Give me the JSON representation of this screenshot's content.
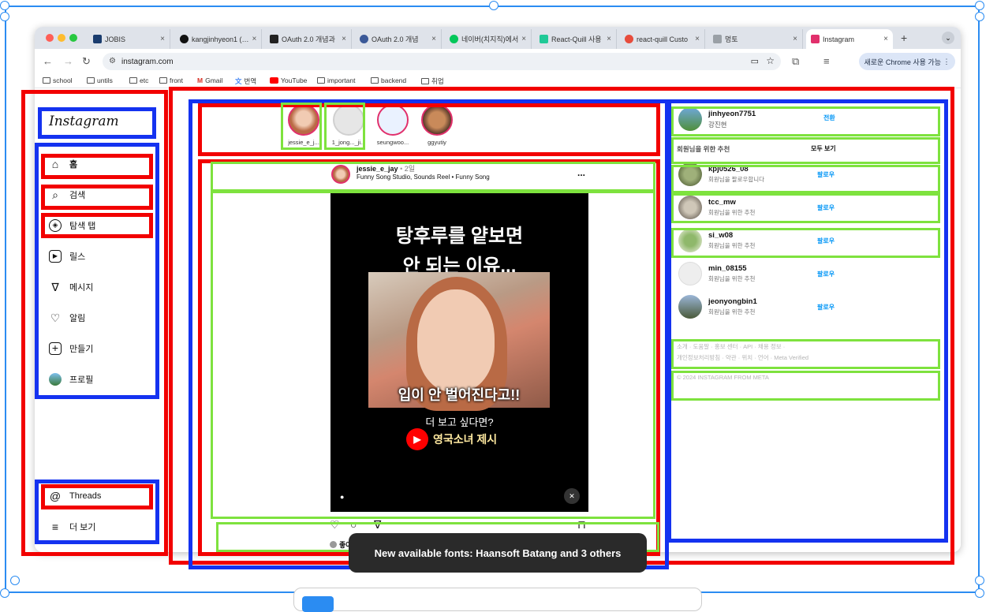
{
  "browser": {
    "tabs": [
      {
        "label": "JOBIS",
        "color": "#1a3c6e"
      },
      {
        "label": "kangjinhyeon1 (…",
        "color": "#111111"
      },
      {
        "label": "OAuth 2.0 개념과",
        "color": "#222222"
      },
      {
        "label": "OAuth 2.0 개념",
        "color": "#3b5998"
      },
      {
        "label": "네이버(치지직)에서",
        "color": "#03c75a"
      },
      {
        "label": "React-Quill 사용",
        "color": "#20c997"
      },
      {
        "label": "react-quill Custo",
        "color": "#e74c3c"
      },
      {
        "label": "멍토",
        "color": "#9aa0a6"
      },
      {
        "label": "Instagram",
        "color": "#e1306c"
      }
    ],
    "new_tab": "+",
    "url": "instagram.com",
    "chrome_button": "새로운 Chrome 사용 가능",
    "bookmarks": [
      "school",
      "untils",
      "etc",
      "front",
      "Gmail",
      "번역",
      "YouTube",
      "important",
      "backend",
      "취업"
    ]
  },
  "sidebar": {
    "logo": "Instagram",
    "items": [
      {
        "label": "홈",
        "icon": "home-icon"
      },
      {
        "label": "검색",
        "icon": "search-icon"
      },
      {
        "label": "탐색 탭",
        "icon": "compass-icon"
      },
      {
        "label": "릴스",
        "icon": "reels-icon"
      },
      {
        "label": "메시지",
        "icon": "send-icon"
      },
      {
        "label": "알림",
        "icon": "heart-icon"
      },
      {
        "label": "만들기",
        "icon": "plus-square-icon"
      },
      {
        "label": "프로필",
        "icon": "profile-avatar"
      }
    ],
    "threads": "Threads",
    "more": "더 보기"
  },
  "stories": [
    {
      "name": "jessie_e_j..."
    },
    {
      "name": "1_jong..._ji..."
    },
    {
      "name": "seungwoo..."
    },
    {
      "name": "ggyutiy"
    }
  ],
  "post": {
    "author": "jessie_e_jay",
    "time": "2일",
    "audio": "Funny Song Studio, Sounds Reel • Funny Song",
    "more": "...",
    "reel_title_line1": "탕후루를 얕보면",
    "reel_title_line2": "안 되는 이유...",
    "photo_caption": "입이 안 벌어진다고!!",
    "cta": "더 보고 싶다면?",
    "channel": "영국소녀 제시",
    "likes_prefix": "좋아"
  },
  "toast": "New available fonts: Haansoft Batang and 3 others",
  "suggestions": {
    "me": {
      "username": "jinhyeon7751",
      "fullname": "강진현",
      "switch": "전환"
    },
    "header": "회원님을 위한 추천",
    "see_all": "모두 보기",
    "follow_label": "팔로우",
    "users": [
      {
        "username": "kpj0526_08",
        "sub": "회원님을 팔로우합니다"
      },
      {
        "username": "tcc_mw",
        "sub": "회원님을 위한 추천"
      },
      {
        "username": "si_w08",
        "sub": "회원님을 위한 추천"
      },
      {
        "username": "min_08155",
        "sub": "회원님을 위한 추천"
      },
      {
        "username": "jeonyongbin1",
        "sub": "회원님을 위한 추천"
      }
    ],
    "footer_line1": "소개 · 도움말 · 홍보 센터 · API · 채용 정보 ·",
    "footer_line2": "개인정보처리방침 · 약관 · 위치 · 언어 · Meta Verified",
    "copyright": "© 2024 INSTAGRAM FROM META"
  }
}
